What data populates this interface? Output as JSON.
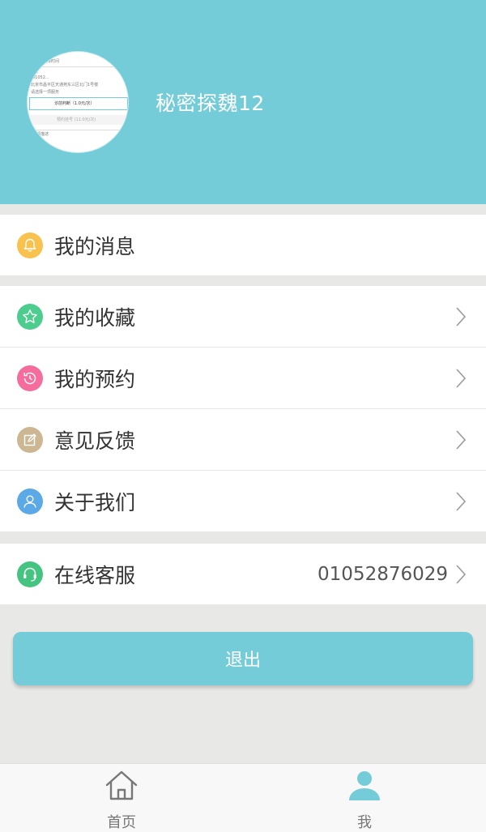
{
  "profile": {
    "username": "秘密探魏12",
    "avatar_lines": [
      "请选择时间",
      "男",
      "01052...",
      "北京市昌平区天通苑东三区北门1号楼",
      "请选择一项服务",
      "诊前判断（1.0元/次）",
      "预约挂号 (11.0元/次)",
      "病情描述"
    ]
  },
  "menu": {
    "messages": {
      "label": "我的消息",
      "icon": "bell-icon",
      "color": "#f9c24e"
    },
    "favorites": {
      "label": "我的收藏",
      "icon": "star-icon",
      "color": "#4ccd8e"
    },
    "appointments": {
      "label": "我的预约",
      "icon": "history-icon",
      "color": "#f56d9c"
    },
    "feedback": {
      "label": "意见反馈",
      "icon": "edit-icon",
      "color": "#cdb792"
    },
    "about": {
      "label": "关于我们",
      "icon": "user-icon",
      "color": "#5ba9e6"
    },
    "service": {
      "label": "在线客服",
      "icon": "headset-icon",
      "color": "#45c481",
      "value": "01052876029"
    }
  },
  "actions": {
    "logout_label": "退出"
  },
  "tabbar": {
    "home_label": "首页",
    "me_label": "我",
    "active_color": "#74ccd8",
    "inactive_color": "#777777"
  }
}
